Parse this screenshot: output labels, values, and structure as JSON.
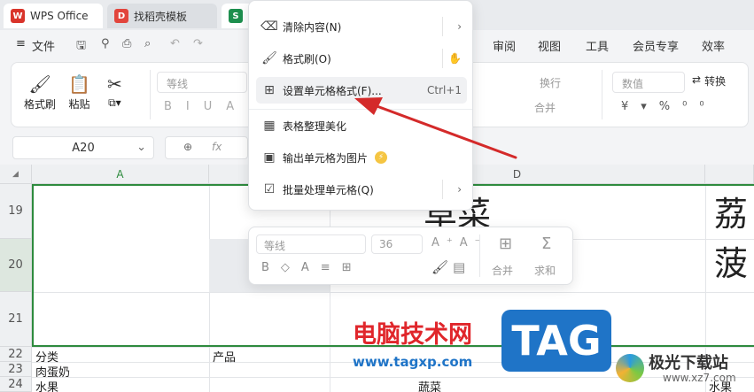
{
  "tabs": [
    {
      "label": "WPS Office",
      "logo": "W",
      "color": "#d9342b"
    },
    {
      "label": "找稻壳模板",
      "logo": "D",
      "color": "#e2453c"
    },
    {
      "label": "",
      "logo": "S",
      "color": "#1d8f4e"
    }
  ],
  "menubar": {
    "file": "文件",
    "items": [
      "审阅",
      "视图",
      "工具",
      "会员专享",
      "效率"
    ]
  },
  "ribbon": {
    "format_painter": "格式刷",
    "paste": "粘贴",
    "font_name": "等线",
    "wrap": "换行",
    "merge": "合并",
    "number_format": "数值",
    "convert": "转换"
  },
  "formula_bar": {
    "name_box": "A20",
    "fx": "fx"
  },
  "columns": [
    "A",
    "",
    "D",
    ""
  ],
  "rows": [
    "19",
    "20",
    "21",
    "22",
    "23",
    "24"
  ],
  "cells": {
    "d19": "草菜",
    "e19": "荔",
    "e20": "菠",
    "a22": "分类",
    "b22": "产品",
    "a23": "肉蛋奶",
    "a24": "水果",
    "d24": "蔬菜",
    "e24": "水果"
  },
  "context_menu": [
    {
      "label": "清除内容(N)",
      "icon": "eraser-icon",
      "shortcut": "",
      "submenu": true
    },
    {
      "label": "格式刷(O)",
      "icon": "format-painter-icon",
      "shortcut": "",
      "submenu": false
    },
    {
      "label": "设置单元格格式(F)...",
      "icon": "cell-format-icon",
      "shortcut": "Ctrl+1",
      "submenu": false
    },
    {
      "label": "表格整理美化",
      "icon": "table-beautify-icon",
      "shortcut": "",
      "submenu": false
    },
    {
      "label": "输出单元格为图片",
      "icon": "image-export-icon",
      "shortcut": "",
      "submenu": false
    },
    {
      "label": "批量处理单元格(Q)",
      "icon": "batch-process-icon",
      "shortcut": "",
      "submenu": true
    }
  ],
  "mini_toolbar": {
    "font": "等线",
    "size": "36",
    "merge": "合并",
    "sum": "求和"
  },
  "watermark": {
    "site_name": "电脑技术网",
    "site_url": "www.tagxp.com",
    "tag": "TAG",
    "brand2": "极光下载站",
    "brand2_url": "www.xz7.com"
  },
  "colors": {
    "selection_border": "#2e8b3e",
    "arrow": "#d42a2a",
    "watermark_red": "#e0262b",
    "tag_blue": "#1f74c7"
  }
}
